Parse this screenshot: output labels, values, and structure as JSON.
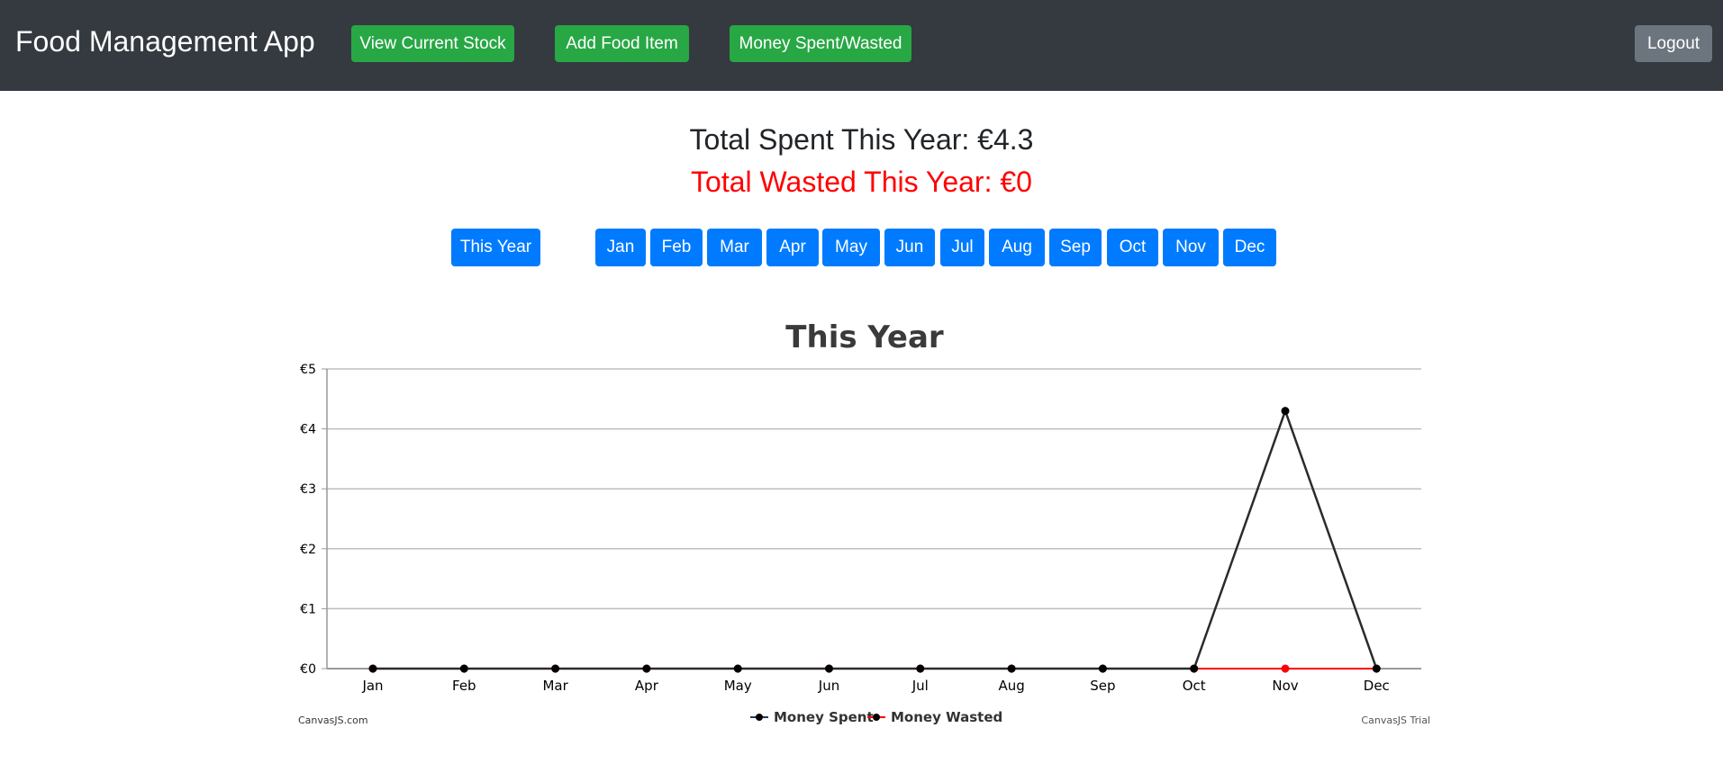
{
  "navbar": {
    "brand": "Food Management App",
    "view_stock": "View Current Stock",
    "add_food": "Add Food Item",
    "money": "Money Spent/Wasted",
    "logout": "Logout"
  },
  "totals": {
    "spent": "Total Spent This Year: €4.3",
    "wasted": "Total Wasted This Year: €0"
  },
  "filters": {
    "this_year": "This Year",
    "months": [
      "Jan",
      "Feb",
      "Mar",
      "Apr",
      "May",
      "Jun",
      "Jul",
      "Aug",
      "Sep",
      "Oct",
      "Nov",
      "Dec"
    ]
  },
  "watermarks": {
    "left": "CanvasJS.com",
    "right": "CanvasJS Trial"
  },
  "chart_data": {
    "type": "line",
    "title": "This Year",
    "categories": [
      "Jan",
      "Feb",
      "Mar",
      "Apr",
      "May",
      "Jun",
      "Jul",
      "Aug",
      "Sep",
      "Oct",
      "Nov",
      "Dec"
    ],
    "y_tick_labels": [
      "€0",
      "€1",
      "€2",
      "€3",
      "€4",
      "€5"
    ],
    "ylim": [
      0,
      5
    ],
    "grid": true,
    "legend_position": "bottom",
    "series": [
      {
        "name": "Money Spent",
        "color": "#000000",
        "values": [
          0,
          0,
          0,
          0,
          0,
          0,
          0,
          0,
          0,
          0,
          4.3,
          0
        ]
      },
      {
        "name": "Money Wasted",
        "color": "#ff0000",
        "values": [
          0,
          0,
          0,
          0,
          0,
          0,
          0,
          0,
          0,
          0,
          0,
          0
        ]
      }
    ]
  }
}
